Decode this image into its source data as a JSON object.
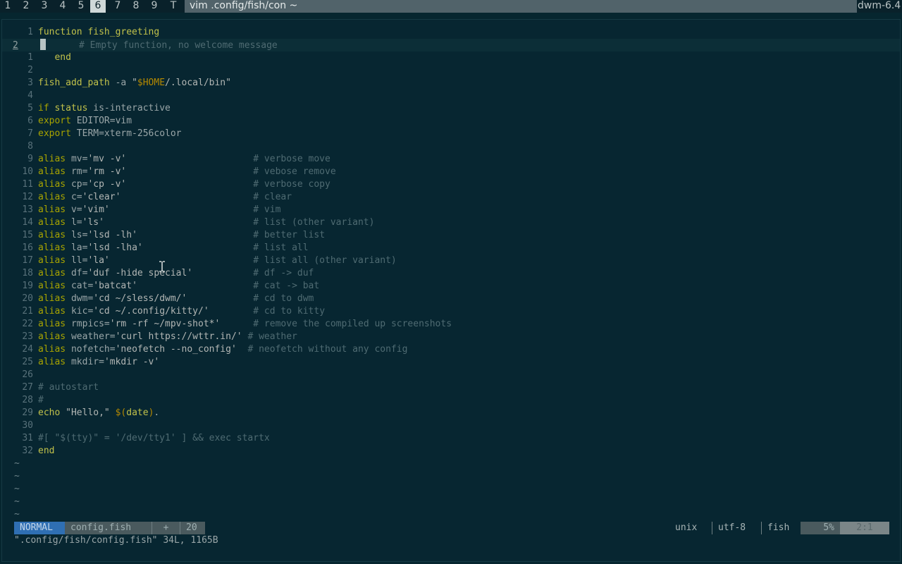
{
  "topbar": {
    "tags": [
      "1",
      "2",
      "3",
      "4",
      "5",
      "6",
      "7",
      "8",
      "9",
      "T"
    ],
    "active_tag_index": 5,
    "window_title": "vim .config/fish/con ~",
    "status_text": "dwm-6.4"
  },
  "editor": {
    "lines": [
      {
        "n": "1",
        "code": [
          [
            "f",
            "function fish_greeting"
          ]
        ]
      },
      {
        "n": "2",
        "cursorline": true,
        "code": [
          [
            "c",
            "      # Empty function, no welcome message"
          ]
        ]
      },
      {
        "n": "1",
        "code": [
          [
            "f",
            "   end"
          ]
        ]
      },
      {
        "n": "2",
        "code": []
      },
      {
        "n": "3",
        "code": [
          [
            "f",
            "fish_add_path"
          ],
          [
            "p",
            " -a "
          ],
          [
            "s",
            "\""
          ],
          [
            "v",
            "$HOME"
          ],
          [
            "s",
            "/.local/bin\""
          ]
        ]
      },
      {
        "n": "4",
        "code": []
      },
      {
        "n": "5",
        "code": [
          [
            "k",
            "if"
          ],
          [
            "p",
            " "
          ],
          [
            "f",
            "status"
          ],
          [
            "p",
            " is-interactive"
          ]
        ]
      },
      {
        "n": "6",
        "code": [
          [
            "k",
            "export"
          ],
          [
            "p",
            " EDITOR=vim"
          ]
        ]
      },
      {
        "n": "7",
        "code": [
          [
            "k",
            "export"
          ],
          [
            "p",
            " TERM=xterm-256color"
          ]
        ]
      },
      {
        "n": "8",
        "code": []
      },
      {
        "n": "9",
        "code": [
          [
            "k",
            "alias"
          ],
          [
            "p",
            " mv="
          ],
          [
            "s",
            "'mv -v'"
          ],
          [
            "p",
            "                       "
          ],
          [
            "c",
            "# verbose move"
          ]
        ]
      },
      {
        "n": "10",
        "code": [
          [
            "k",
            "alias"
          ],
          [
            "p",
            " rm="
          ],
          [
            "s",
            "'rm -v'"
          ],
          [
            "p",
            "                       "
          ],
          [
            "c",
            "# vebose remove"
          ]
        ]
      },
      {
        "n": "11",
        "code": [
          [
            "k",
            "alias"
          ],
          [
            "p",
            " cp="
          ],
          [
            "s",
            "'cp -v'"
          ],
          [
            "p",
            "                       "
          ],
          [
            "c",
            "# verbose copy"
          ]
        ]
      },
      {
        "n": "12",
        "code": [
          [
            "k",
            "alias"
          ],
          [
            "p",
            " c="
          ],
          [
            "s",
            "'clear'"
          ],
          [
            "p",
            "                        "
          ],
          [
            "c",
            "# clear"
          ]
        ]
      },
      {
        "n": "13",
        "code": [
          [
            "k",
            "alias"
          ],
          [
            "p",
            " v="
          ],
          [
            "s",
            "'vim'"
          ],
          [
            "p",
            "                          "
          ],
          [
            "c",
            "# vim"
          ]
        ]
      },
      {
        "n": "14",
        "code": [
          [
            "k",
            "alias"
          ],
          [
            "p",
            " l="
          ],
          [
            "s",
            "'ls'"
          ],
          [
            "p",
            "                           "
          ],
          [
            "c",
            "# list (other variant)"
          ]
        ]
      },
      {
        "n": "15",
        "code": [
          [
            "k",
            "alias"
          ],
          [
            "p",
            " ls="
          ],
          [
            "s",
            "'lsd -lh'"
          ],
          [
            "p",
            "                     "
          ],
          [
            "c",
            "# better list"
          ]
        ]
      },
      {
        "n": "16",
        "code": [
          [
            "k",
            "alias"
          ],
          [
            "p",
            " la="
          ],
          [
            "s",
            "'lsd -lha'"
          ],
          [
            "p",
            "                    "
          ],
          [
            "c",
            "# list all"
          ]
        ]
      },
      {
        "n": "17",
        "code": [
          [
            "k",
            "alias"
          ],
          [
            "p",
            " ll="
          ],
          [
            "s",
            "'la'"
          ],
          [
            "p",
            "                          "
          ],
          [
            "c",
            "# list all (other variant)"
          ]
        ]
      },
      {
        "n": "18",
        "code": [
          [
            "k",
            "alias"
          ],
          [
            "p",
            " df="
          ],
          [
            "s",
            "'duf -hide special'"
          ],
          [
            "p",
            "           "
          ],
          [
            "c",
            "# df -> duf"
          ]
        ]
      },
      {
        "n": "19",
        "code": [
          [
            "k",
            "alias"
          ],
          [
            "p",
            " cat="
          ],
          [
            "s",
            "'batcat'"
          ],
          [
            "p",
            "                     "
          ],
          [
            "c",
            "# cat -> bat"
          ]
        ]
      },
      {
        "n": "20",
        "code": [
          [
            "k",
            "alias"
          ],
          [
            "p",
            " dwm="
          ],
          [
            "s",
            "'cd ~/sless/dwm/'"
          ],
          [
            "p",
            "            "
          ],
          [
            "c",
            "# cd to dwm"
          ]
        ]
      },
      {
        "n": "21",
        "code": [
          [
            "k",
            "alias"
          ],
          [
            "p",
            " kic="
          ],
          [
            "s",
            "'cd ~/.config/kitty/'"
          ],
          [
            "p",
            "        "
          ],
          [
            "c",
            "# cd to kitty"
          ]
        ]
      },
      {
        "n": "22",
        "code": [
          [
            "k",
            "alias"
          ],
          [
            "p",
            " rmpics="
          ],
          [
            "s",
            "'rm -rf ~/mpv-shot*'"
          ],
          [
            "p",
            "      "
          ],
          [
            "c",
            "# remove the compiled up screenshots"
          ]
        ]
      },
      {
        "n": "23",
        "code": [
          [
            "k",
            "alias"
          ],
          [
            "p",
            " weather="
          ],
          [
            "s",
            "'curl https://wttr.in/'"
          ],
          [
            "p",
            " "
          ],
          [
            "c",
            "# weather"
          ]
        ]
      },
      {
        "n": "24",
        "code": [
          [
            "k",
            "alias"
          ],
          [
            "p",
            " nofetch="
          ],
          [
            "s",
            "'neofetch --no_config'"
          ],
          [
            "p",
            "  "
          ],
          [
            "c",
            "# neofetch without any config"
          ]
        ]
      },
      {
        "n": "25",
        "code": [
          [
            "k",
            "alias"
          ],
          [
            "p",
            " mkdir="
          ],
          [
            "s",
            "'mkdir -v'"
          ]
        ]
      },
      {
        "n": "26",
        "code": []
      },
      {
        "n": "27",
        "code": [
          [
            "c",
            "# autostart"
          ]
        ]
      },
      {
        "n": "28",
        "code": [
          [
            "c",
            "#"
          ]
        ]
      },
      {
        "n": "29",
        "code": [
          [
            "f",
            "echo"
          ],
          [
            "p",
            " "
          ],
          [
            "s",
            "\"Hello,\""
          ],
          [
            "p",
            " "
          ],
          [
            "v",
            "$("
          ],
          [
            "f",
            "date"
          ],
          [
            "v",
            ")"
          ],
          [
            "p",
            "."
          ]
        ]
      },
      {
        "n": "30",
        "code": []
      },
      {
        "n": "31",
        "code": [
          [
            "c",
            "#[ \"$(tty)\" = '/dev/tty1' ] && exec startx"
          ]
        ]
      },
      {
        "n": "32",
        "code": [
          [
            "f",
            "end"
          ]
        ]
      }
    ],
    "tildes": [
      "~",
      "~",
      "~",
      "~",
      "~"
    ]
  },
  "statusline": {
    "mode": "NORMAL",
    "file": "config.fish",
    "modified": "+",
    "num": "20",
    "fileformat": "unix",
    "encoding": "utf-8",
    "filetype": "fish",
    "percent": "5%",
    "position": "2:1"
  },
  "cmdline": "\".config/fish/config.fish\" 34L, 1165B"
}
